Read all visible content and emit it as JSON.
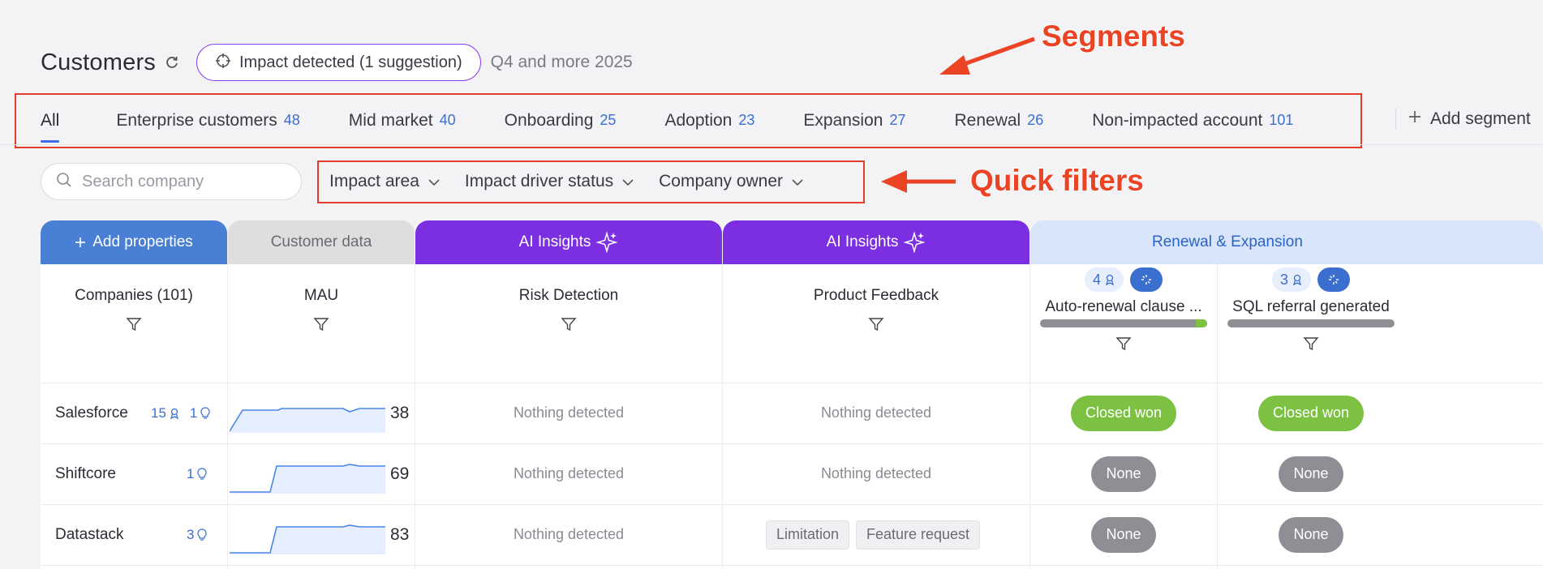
{
  "header": {
    "title": "Customers",
    "impact_pill": "Impact detected (1 suggestion)",
    "period": "Q4 and more 2025"
  },
  "annotations": {
    "segments": "Segments",
    "quick_filters": "Quick filters"
  },
  "tabs": [
    {
      "label": "All",
      "count": ""
    },
    {
      "label": "Enterprise customers",
      "count": "48"
    },
    {
      "label": "Mid market",
      "count": "40"
    },
    {
      "label": "Onboarding",
      "count": "25"
    },
    {
      "label": "Adoption",
      "count": "23"
    },
    {
      "label": "Expansion",
      "count": "27"
    },
    {
      "label": "Renewal",
      "count": "26"
    },
    {
      "label": "Non-impacted account",
      "count": "101"
    }
  ],
  "add_segment": "Add segment",
  "search": {
    "placeholder": "Search company"
  },
  "filters": [
    "Impact area",
    "Impact driver status",
    "Company owner"
  ],
  "column_groups": {
    "add_properties": "Add properties",
    "customer_data": "Customer data",
    "ai_insights_1": "AI Insights",
    "ai_insights_2": "AI Insights",
    "renewal": "Renewal & Expansion"
  },
  "columns": {
    "companies": "Companies (101)",
    "mau": "MAU",
    "risk": "Risk Detection",
    "feedback": "Product Feedback",
    "auto_renewal": {
      "label": "Auto-renewal clause ...",
      "badge_count": "4",
      "progress": 0.07
    },
    "sql_referral": {
      "label": "SQL referral generated",
      "badge_count": "3",
      "progress": 0.0
    }
  },
  "rows": [
    {
      "company": "Salesforce",
      "count_a": "15",
      "count_b": "1",
      "mau": "38",
      "risk": "Nothing detected",
      "feedback": "Nothing detected",
      "feedback_tags": [],
      "renewal": "Closed won",
      "sql": "Closed won"
    },
    {
      "company": "Shiftcore",
      "count_a": "",
      "count_b": "1",
      "mau": "69",
      "risk": "Nothing detected",
      "feedback": "Nothing detected",
      "feedback_tags": [],
      "renewal": "None",
      "sql": "None"
    },
    {
      "company": "Datastack",
      "count_a": "",
      "count_b": "3",
      "mau": "83",
      "risk": "Nothing detected",
      "feedback": "",
      "feedback_tags": [
        "Limitation",
        "Feature request"
      ],
      "renewal": "None",
      "sql": "None"
    }
  ],
  "colors": {
    "accent_blue": "#3b6ee8",
    "ai_purple": "#7b2fe0",
    "renewal_header": "#d8e5fb",
    "won_green": "#7cc142",
    "none_gray": "#8e8e94",
    "annotation_red": "#ea4425"
  }
}
